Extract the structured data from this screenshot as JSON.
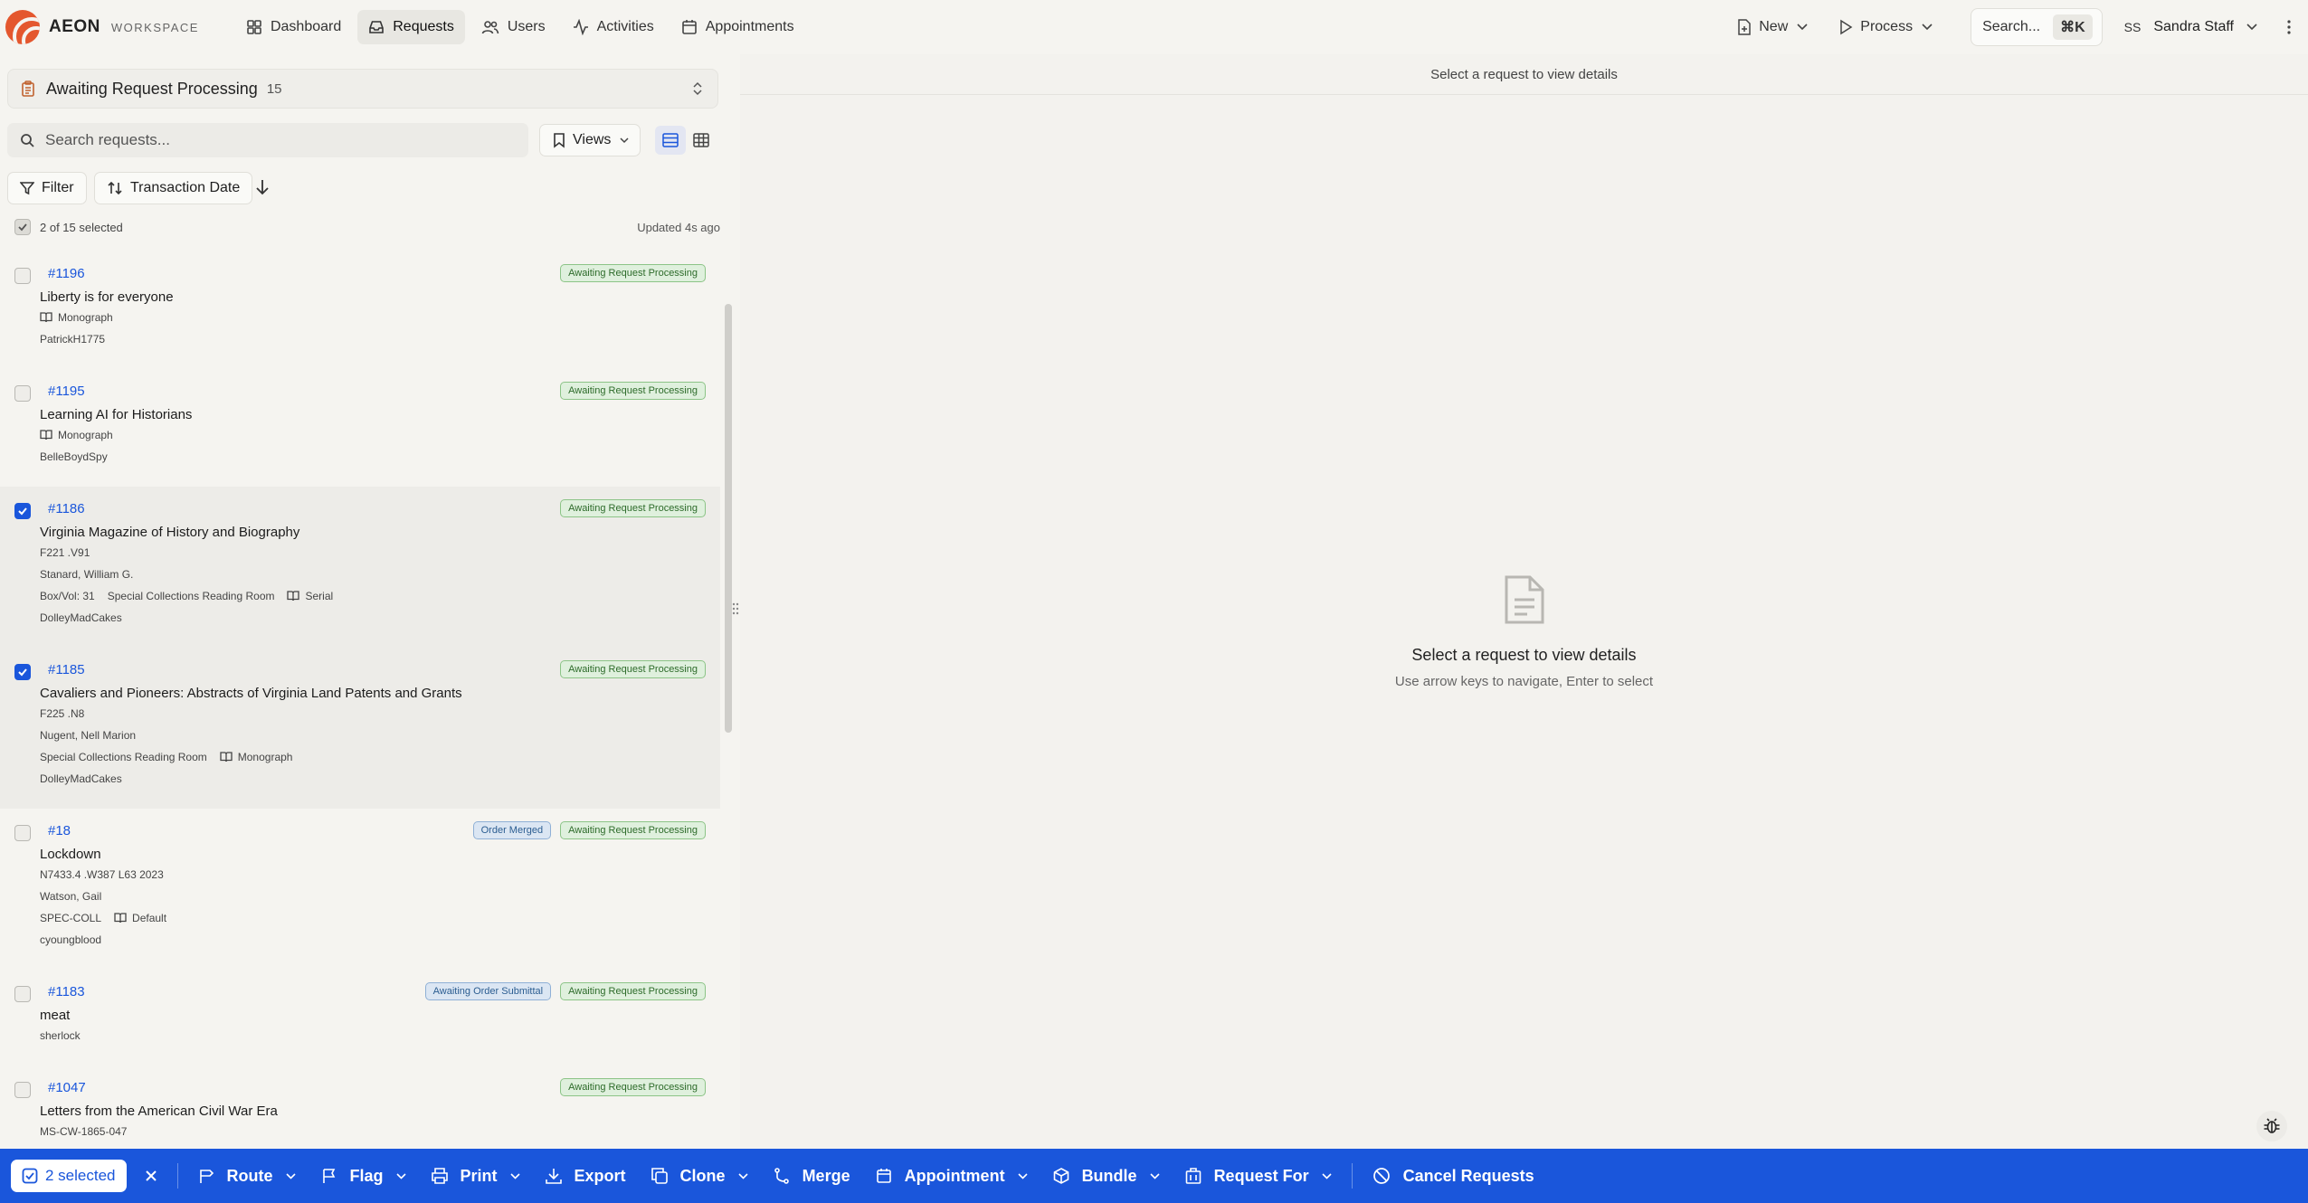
{
  "app": {
    "name": "AEON",
    "subtitle": "WORKSPACE"
  },
  "nav": {
    "items": [
      {
        "label": "Dashboard",
        "icon": "grid-icon",
        "active": false
      },
      {
        "label": "Requests",
        "icon": "inbox-icon",
        "active": true
      },
      {
        "label": "Users",
        "icon": "users-icon",
        "active": false
      },
      {
        "label": "Activities",
        "icon": "activity-icon",
        "active": false
      },
      {
        "label": "Appointments",
        "icon": "calendar-icon",
        "active": false
      }
    ]
  },
  "topright": {
    "new_label": "New",
    "process_label": "Process",
    "search_label": "Search...",
    "search_shortcut": "⌘K",
    "user_initials": "SS",
    "user_name": "Sandra Staff"
  },
  "queue": {
    "title": "Awaiting Request Processing",
    "count": "15"
  },
  "search": {
    "placeholder": "Search requests..."
  },
  "toolbar": {
    "views_label": "Views",
    "filter_label": "Filter",
    "sort_label": "Transaction Date"
  },
  "selection": {
    "text": "2 of 15 selected",
    "updated": "Updated 4s ago"
  },
  "requests": [
    {
      "id": "#1196",
      "title": "Liberty is for everyone",
      "badges": [
        "Awaiting Request Processing"
      ],
      "checked": false,
      "type": "Monograph",
      "user": "PatrickH1775"
    },
    {
      "id": "#1195",
      "title": "Learning AI for Historians",
      "badges": [
        "Awaiting Request Processing"
      ],
      "checked": false,
      "type": "Monograph",
      "user": "BelleBoydSpy"
    },
    {
      "id": "#1186",
      "title": "Virginia Magazine of History and Biography",
      "badges": [
        "Awaiting Request Processing"
      ],
      "checked": true,
      "callnum": "F221 .V91",
      "author": "Stanard, William G.",
      "boxvol": "Box/Vol: 31",
      "location": "Special Collections Reading Room",
      "type": "Serial",
      "user": "DolleyMadCakes"
    },
    {
      "id": "#1185",
      "title": "Cavaliers and Pioneers: Abstracts of Virginia Land Patents and Grants",
      "badges": [
        "Awaiting Request Processing"
      ],
      "checked": true,
      "callnum": "F225 .N8",
      "author": "Nugent, Nell Marion",
      "location": "Special Collections Reading Room",
      "type": "Monograph",
      "user": "DolleyMadCakes"
    },
    {
      "id": "#18",
      "title": "Lockdown",
      "badges": [
        "Order Merged",
        "Awaiting Request Processing"
      ],
      "checked": false,
      "callnum": "N7433.4 .W387 L63 2023",
      "author": "Watson, Gail",
      "location": "SPEC-COLL",
      "type": "Default",
      "user": "cyoungblood"
    },
    {
      "id": "#1183",
      "title": "meat",
      "badges": [
        "Awaiting Order Submittal",
        "Awaiting Request Processing"
      ],
      "checked": false,
      "user": "sherlock"
    },
    {
      "id": "#1047",
      "title": "Letters from the American Civil War Era",
      "badges": [
        "Awaiting Request Processing"
      ],
      "checked": false,
      "callnum": "MS-CW-1865-047"
    }
  ],
  "detail": {
    "header": "Select a request to view details",
    "empty_title": "Select a request to view details",
    "empty_sub": "Use arrow keys to navigate, Enter to select"
  },
  "actionbar": {
    "selected_label": "2 selected",
    "buttons": [
      {
        "label": "Route",
        "icon": "route-icon",
        "dropdown": true
      },
      {
        "label": "Flag",
        "icon": "flag-icon",
        "dropdown": true
      },
      {
        "label": "Print",
        "icon": "printer-icon",
        "dropdown": true
      },
      {
        "label": "Export",
        "icon": "download-icon",
        "dropdown": false
      },
      {
        "label": "Clone",
        "icon": "copy-icon",
        "dropdown": true
      },
      {
        "label": "Merge",
        "icon": "merge-icon",
        "dropdown": false
      },
      {
        "label": "Appointment",
        "icon": "calendar-icon",
        "dropdown": true
      },
      {
        "label": "Bundle",
        "icon": "package-icon",
        "dropdown": true
      },
      {
        "label": "Request For",
        "icon": "building-icon",
        "dropdown": true
      },
      {
        "label": "Cancel Requests",
        "icon": "ban-icon",
        "dropdown": false
      }
    ]
  },
  "colors": {
    "accent": "#1a56db",
    "brand": "#e4572e",
    "status_green": "#dff0dd",
    "status_blue": "#dbe6f3"
  }
}
